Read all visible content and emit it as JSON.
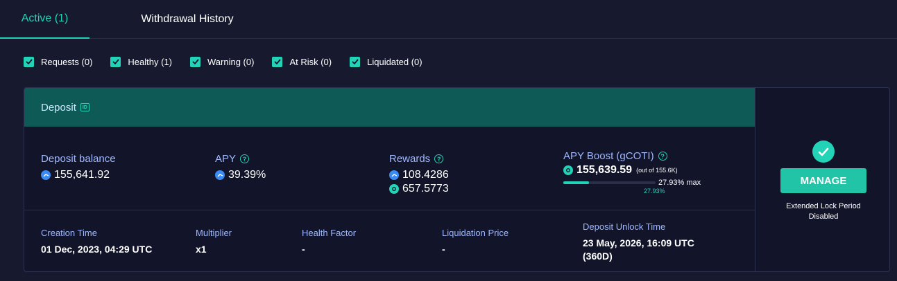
{
  "tabs": {
    "active": "Active (1)",
    "history": "Withdrawal History"
  },
  "filters": [
    {
      "label": "Requests (0)",
      "checked": true
    },
    {
      "label": "Healthy (1)",
      "checked": true
    },
    {
      "label": "Warning (0)",
      "checked": true
    },
    {
      "label": "At Risk (0)",
      "checked": true
    },
    {
      "label": "Liquidated (0)",
      "checked": true
    }
  ],
  "card": {
    "title": "Deposit",
    "id_icon": "ID",
    "metrics": {
      "deposit_balance_label": "Deposit balance",
      "deposit_balance_value": "155,641.92",
      "apy_label": "APY",
      "apy_value": "39.39%",
      "rewards_label": "Rewards",
      "rewards_value_1": "108.4286",
      "rewards_value_2": "657.5773",
      "boost_label": "APY Boost (gCOTI)",
      "boost_value": "155,639.59",
      "boost_outof": "(out of 155.6K)",
      "boost_max": "27.93% max",
      "boost_pct": "27.93%",
      "boost_fraction": 0.2793
    },
    "footer": {
      "creation_label": "Creation Time",
      "creation_value": "01 Dec, 2023, 04:29 UTC",
      "multiplier_label": "Multiplier",
      "multiplier_value": "x1",
      "health_label": "Health Factor",
      "health_value": "-",
      "liq_label": "Liquidation Price",
      "liq_value": "-",
      "unlock_label": "Deposit Unlock Time",
      "unlock_value_1": "23 May, 2026, 16:09 UTC",
      "unlock_value_2": "(360D)"
    },
    "side": {
      "manage_label": "MANAGE",
      "note_1": "Extended Lock Period",
      "note_2": "Disabled"
    }
  },
  "colors": {
    "accent": "#22d3b7",
    "header_bg": "#0d5a57",
    "page_bg": "#171a2e"
  }
}
